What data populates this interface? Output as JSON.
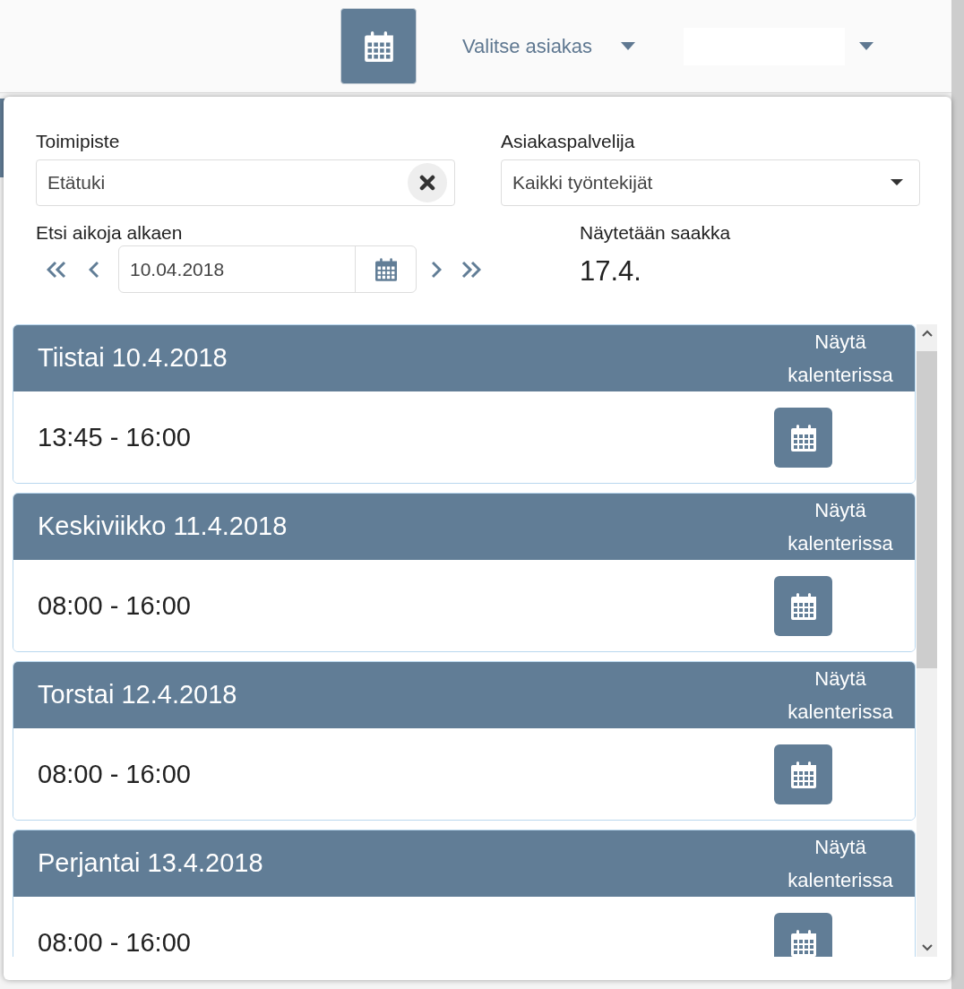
{
  "top_bar": {
    "customer_select": {
      "label": "Valitse asiakas"
    }
  },
  "filters": {
    "office": {
      "label": "Toimipiste",
      "value": "Etätuki"
    },
    "agent": {
      "label": "Asiakaspalvelija",
      "value": "Kaikki työntekijät"
    },
    "start": {
      "label": "Etsi aikoja alkaen",
      "value": "10.04.2018"
    },
    "until": {
      "label": "Näytetään saakka",
      "value": "17.4."
    }
  },
  "days": [
    {
      "title": "Tiistai 10.4.2018",
      "action": "Näytä kalenterissa",
      "time": "13:45 - 16:00"
    },
    {
      "title": "Keskiviikko 11.4.2018",
      "action": "Näytä kalenterissa",
      "time": "08:00 - 16:00"
    },
    {
      "title": "Torstai 12.4.2018",
      "action": "Näytä kalenterissa",
      "time": "08:00 - 16:00"
    },
    {
      "title": "Perjantai 13.4.2018",
      "action": "Näytä kalenterissa",
      "time": "08:00 - 16:00"
    }
  ]
}
